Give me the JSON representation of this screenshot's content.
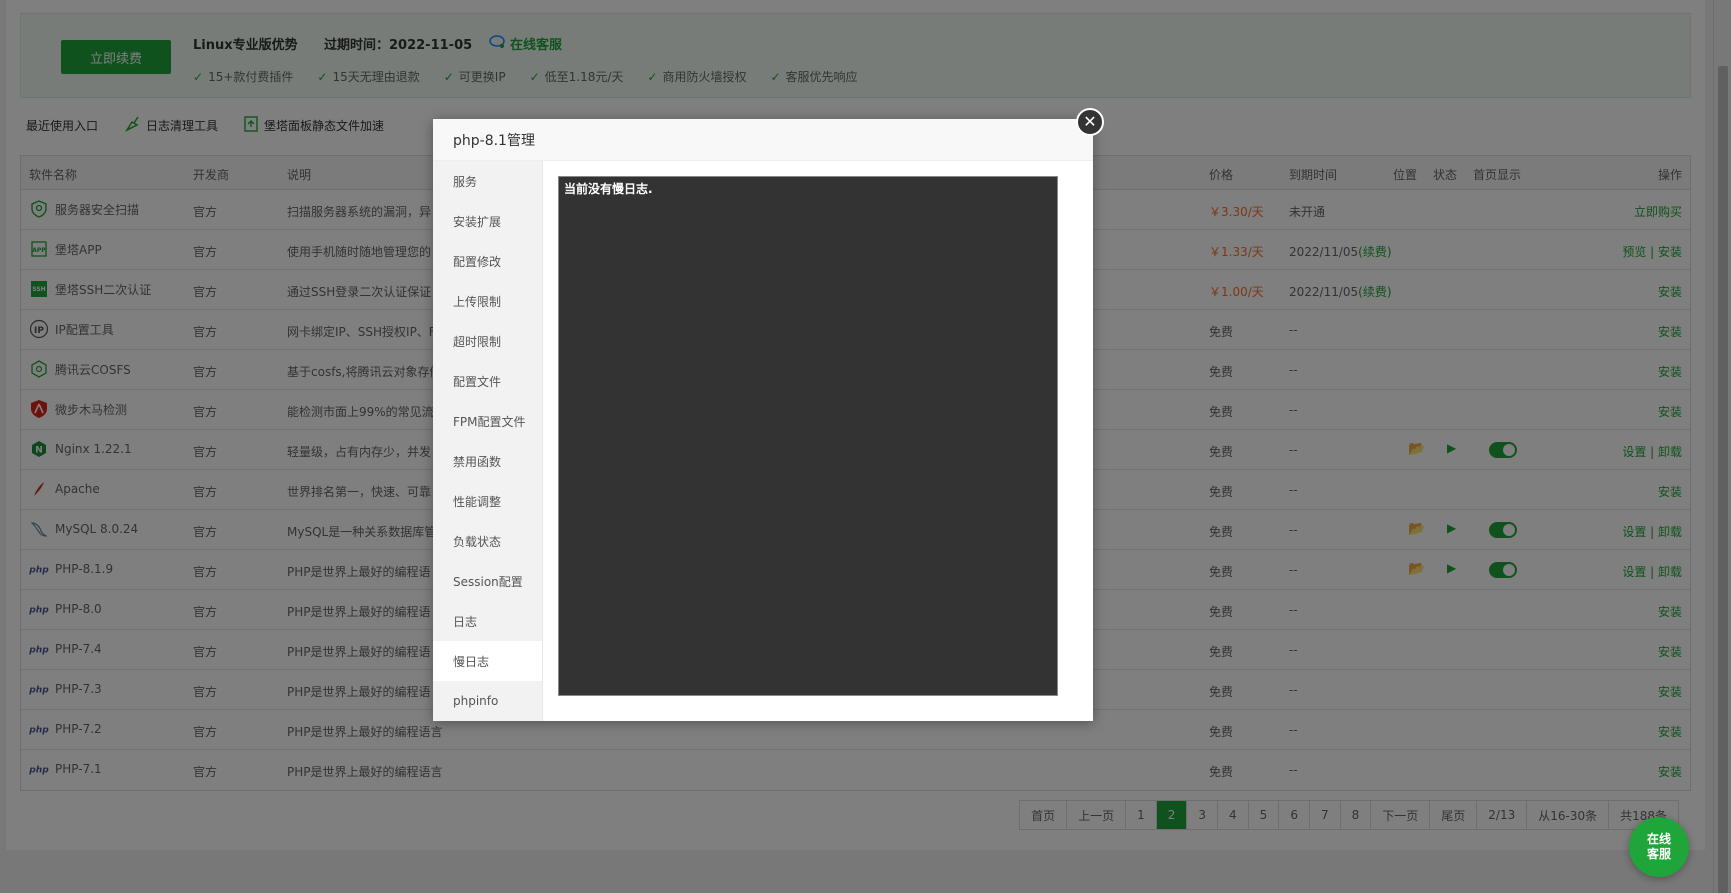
{
  "promo": {
    "renew_label": "立即续费",
    "title": "Linux专业版优势",
    "expire": "过期时间：2022-11-05",
    "service": "在线客服",
    "features": [
      "15+款付费插件",
      "15天无理由退款",
      "可更换IP",
      "低至1.18元/天",
      "商用防火墙授权",
      "客服优先响应"
    ]
  },
  "quick_bar": {
    "label": "最近使用入口",
    "items": [
      "日志清理工具",
      "堡塔面板静态文件加速"
    ]
  },
  "table": {
    "headers": {
      "name": "软件名称",
      "dev": "开发商",
      "desc": "说明",
      "price": "价格",
      "expire": "到期时间",
      "location": "位置",
      "status": "状态",
      "home": "首页显示",
      "ops": "操作"
    },
    "rows": [
      {
        "name": "服务器安全扫描",
        "icon": "shield-scan-icon",
        "dev": "官方",
        "desc": "扫描服务器系统的漏洞，异",
        "price": "￥3.30/天",
        "expire": "未开通",
        "ops": "立即购买"
      },
      {
        "name": "堡塔APP",
        "icon": "app-icon",
        "dev": "官方",
        "desc": "使用手机随时随地管理您的",
        "price": "￥1.33/天",
        "expire": "2022/11/05",
        "renew": "(续费)",
        "ops": "预览 | 安装"
      },
      {
        "name": "堡塔SSH二次认证",
        "icon": "ssh-icon",
        "dev": "官方",
        "desc": "通过SSH登录二次认证保证",
        "price": "￥1.00/天",
        "expire": "2022/11/05",
        "renew": "(续费)",
        "ops": "安装"
      },
      {
        "name": "IP配置工具",
        "icon": "ip-icon",
        "dev": "官方",
        "desc": "网卡绑定IP、SSH授权IP、F",
        "price": "免费",
        "expire": "--",
        "ops": "安装"
      },
      {
        "name": "腾讯云COSFS",
        "icon": "cosfs-icon",
        "dev": "官方",
        "desc": "基于cosfs,将腾讯云对象存储",
        "price": "免费",
        "expire": "--",
        "ops": "安装"
      },
      {
        "name": "微步木马检测",
        "icon": "trojan-icon",
        "dev": "官方",
        "desc": "能检测市面上99%的常见流",
        "price": "免费",
        "expire": "--",
        "ops": "安装"
      },
      {
        "name": "Nginx 1.22.1",
        "icon": "nginx-icon",
        "dev": "官方",
        "desc": "轻量级，占有内存少，并发",
        "price": "免费",
        "expire": "--",
        "ops": "设置 | 卸载",
        "tools": true
      },
      {
        "name": "Apache",
        "icon": "apache-feather-icon",
        "dev": "官方",
        "desc": "世界排名第一，快速、可靠",
        "price": "免费",
        "expire": "--",
        "ops": "安装"
      },
      {
        "name": "MySQL 8.0.24",
        "icon": "mysql-dolphin-icon",
        "dev": "官方",
        "desc": "MySQL是一种关系数据库管",
        "price": "免费",
        "expire": "--",
        "ops": "设置 | 卸载",
        "tools": true
      },
      {
        "name": "PHP-8.1.9",
        "icon": "php-icon",
        "dev": "官方",
        "desc": "PHP是世界上最好的编程语",
        "price": "免费",
        "expire": "--",
        "ops": "设置 | 卸载",
        "tools": true
      },
      {
        "name": "PHP-8.0",
        "icon": "php-icon",
        "dev": "官方",
        "desc": "PHP是世界上最好的编程语",
        "price": "免费",
        "expire": "--",
        "ops": "安装"
      },
      {
        "name": "PHP-7.4",
        "icon": "php-icon",
        "dev": "官方",
        "desc": "PHP是世界上最好的编程语",
        "price": "免费",
        "expire": "--",
        "ops": "安装"
      },
      {
        "name": "PHP-7.3",
        "icon": "php-icon",
        "dev": "官方",
        "desc": "PHP是世界上最好的编程语",
        "price": "免费",
        "expire": "--",
        "ops": "安装"
      },
      {
        "name": "PHP-7.2",
        "icon": "php-icon",
        "dev": "官方",
        "desc": "PHP是世界上最好的编程语言",
        "price": "免费",
        "expire": "--",
        "ops": "安装"
      },
      {
        "name": "PHP-7.1",
        "icon": "php-icon",
        "dev": "官方",
        "desc": "PHP是世界上最好的编程语言",
        "price": "免费",
        "expire": "--",
        "ops": "安装"
      }
    ]
  },
  "pager": {
    "items": [
      "首页",
      "上一页",
      "1",
      "2",
      "3",
      "4",
      "5",
      "6",
      "7",
      "8",
      "下一页",
      "尾页",
      "2/13",
      "从16-30条",
      "共188条"
    ],
    "current": "2"
  },
  "chat": {
    "label_line1": "在线",
    "label_line2": "客服"
  },
  "modal": {
    "title": "php-8.1管理",
    "close": "✕",
    "menu": [
      "服务",
      "安装扩展",
      "配置修改",
      "上传限制",
      "超时限制",
      "配置文件",
      "FPM配置文件",
      "禁用函数",
      "性能调整",
      "负载状态",
      "Session配置",
      "日志",
      "慢日志",
      "phpinfo"
    ],
    "active": "慢日志",
    "log_text": "当前没有慢日志."
  },
  "colors": {
    "accent": "#20a53a",
    "price": "#fc6d26",
    "log_bg": "#333333"
  }
}
